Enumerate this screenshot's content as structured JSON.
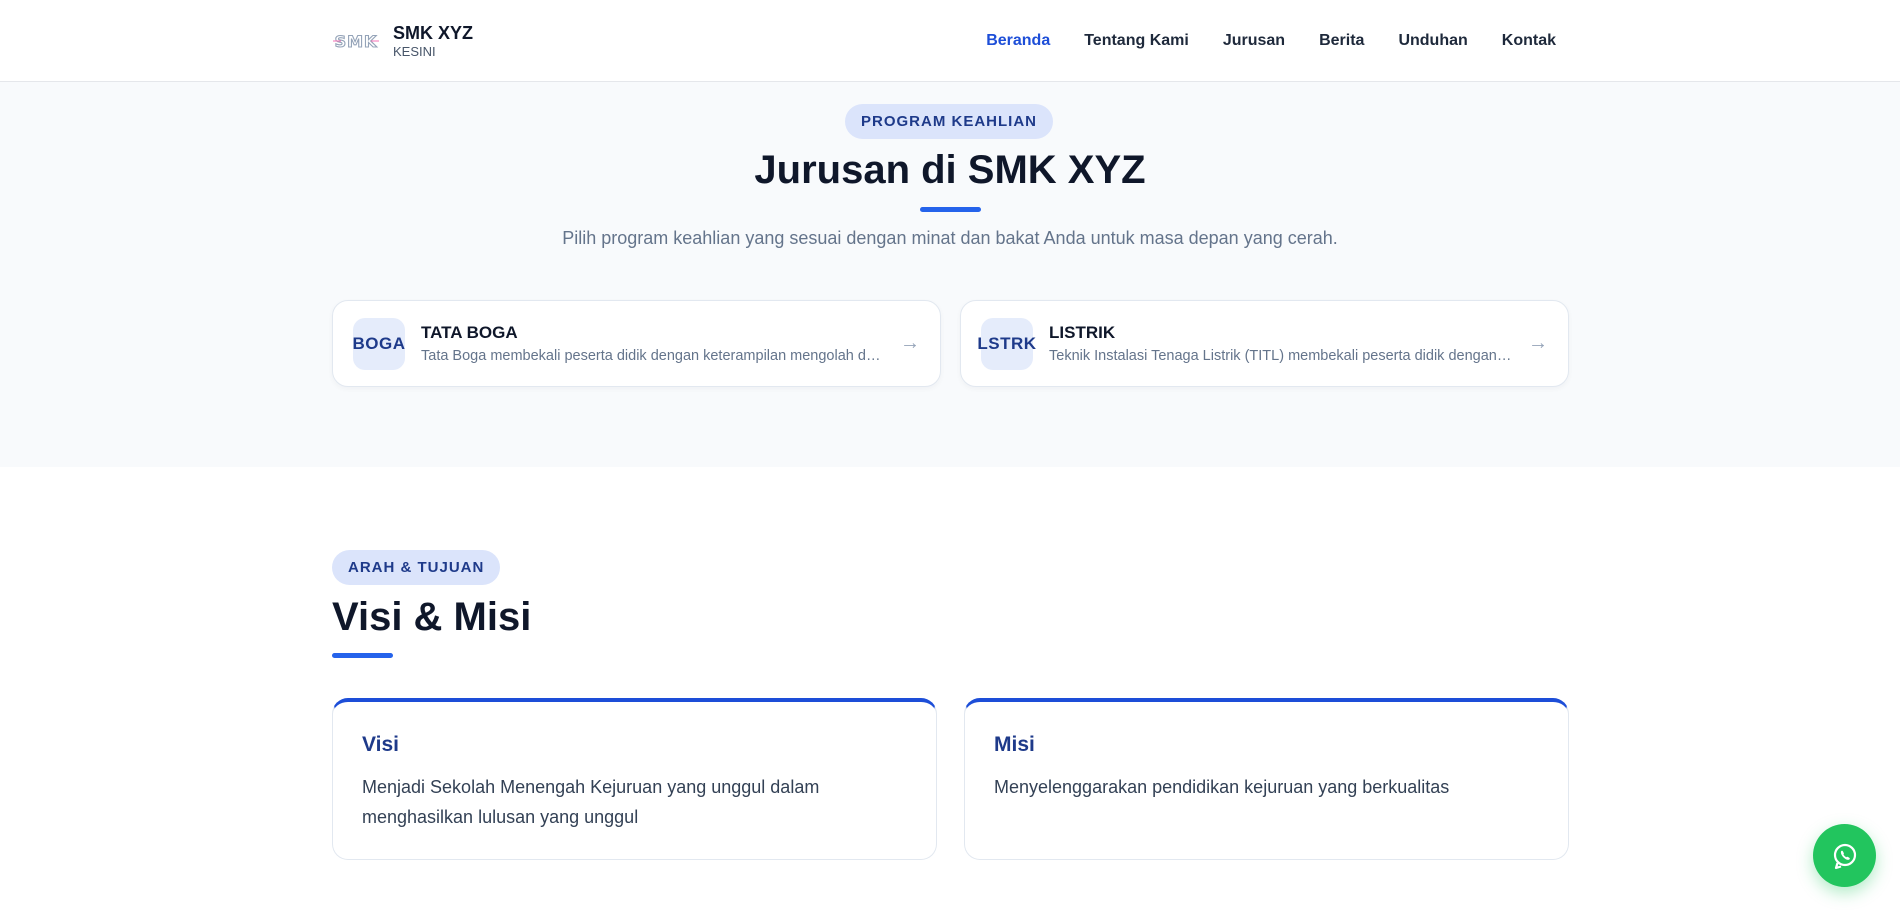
{
  "header": {
    "brand_name": "SMK XYZ",
    "brand_sub": "KESINI",
    "nav": [
      "Beranda",
      "Tentang Kami",
      "Jurusan",
      "Berita",
      "Unduhan",
      "Kontak"
    ],
    "active_nav": "Beranda"
  },
  "programs": {
    "pill": "PROGRAM KEAHLIAN",
    "title": "Jurusan di SMK XYZ",
    "subtitle": "Pilih program keahlian yang sesuai dengan minat dan bakat Anda untuk masa depan yang cerah.",
    "cards": [
      {
        "badge": "BOGA",
        "title": "TATA BOGA",
        "desc": "Tata Boga membekali peserta didik dengan keterampilan mengolah da..."
      },
      {
        "badge": "LSTRK",
        "title": "LISTRIK",
        "desc": "Teknik Instalasi Tenaga Listrik (TITL) membekali peserta didik dengan k..."
      }
    ],
    "arrow": "→"
  },
  "vision": {
    "pill": "ARAH & TUJUAN",
    "title": "Visi & Misi",
    "visi_title": "Visi",
    "visi_text": "Menjadi Sekolah Menengah Kejuruan yang unggul dalam menghasilkan lulusan yang unggul",
    "misi_title": "Misi",
    "misi_text": "Menyelenggarakan pendidikan kejuruan yang berkualitas"
  },
  "colors": {
    "accent": "#2563eb",
    "brand_dark": "#1e3a8a",
    "whatsapp": "#22c55e"
  },
  "icons": [
    "school-logo-icon",
    "arrow-right-icon",
    "whatsapp-icon"
  ]
}
